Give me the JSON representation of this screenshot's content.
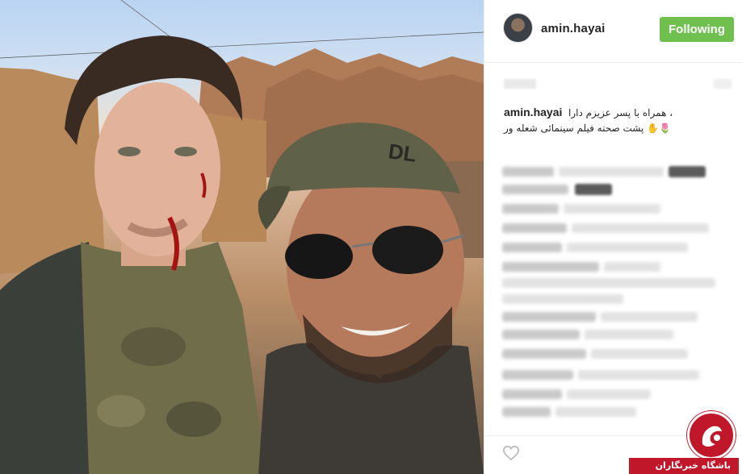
{
  "post": {
    "username": "amin.hayai",
    "follow_button": "Following",
    "caption_user": "amin.hayai",
    "caption_line1": "همراه با پسر عزیزم دارا ،",
    "caption_line2": "🌷✋ پشت صحنه فیلم سینمائی شعله ور"
  },
  "photo": {
    "cap_logo_text": "DL"
  },
  "watermark": {
    "text": "باشگاه خبرنگاران"
  },
  "icons": {
    "heart": "heart-icon",
    "watermark_logo": "logo-icon"
  },
  "colors": {
    "follow_green": "#70c050",
    "watermark_red": "#c0182a"
  }
}
